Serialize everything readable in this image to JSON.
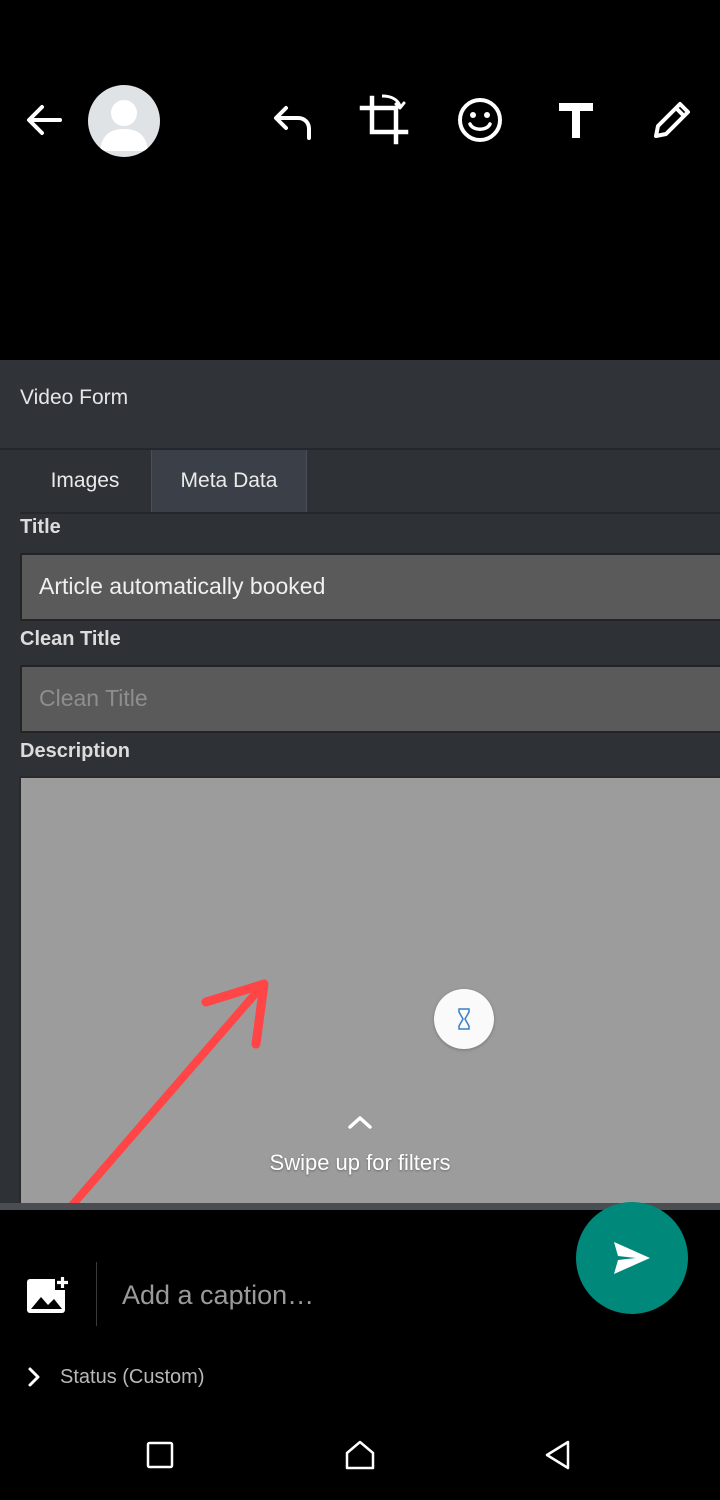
{
  "toolbar": {
    "back_icon": "arrow-left-icon",
    "avatar_icon": "person-avatar-icon",
    "undo_icon": "undo-icon",
    "crop_icon": "crop-rotate-icon",
    "emoji_icon": "smiley-icon",
    "text_icon": "text-icon",
    "draw_icon": "pencil-icon"
  },
  "screenshot": {
    "form_title": "Video Form",
    "tabs": [
      {
        "label": "Images",
        "active": false
      },
      {
        "label": "Meta Data",
        "active": true
      }
    ],
    "fields": {
      "title_label": "Title",
      "title_value": "Article automatically booked",
      "clean_title_label": "Clean Title",
      "clean_title_placeholder": "Clean Title",
      "description_label": "Description"
    },
    "annotation_arrow_color": "#ff4545",
    "loading_icon": "hourglass-icon"
  },
  "swipe_hint": {
    "text": "Swipe up for filters",
    "icon": "chevron-up-icon"
  },
  "caption_bar": {
    "add_media_icon": "add-photo-icon",
    "caption_placeholder": "Add a caption…",
    "send_icon": "send-icon",
    "send_color": "#00897b",
    "status_label": "Status (Custom)"
  },
  "system_nav": {
    "recents_icon": "square-icon",
    "home_icon": "home-icon",
    "back_icon": "triangle-back-icon"
  }
}
